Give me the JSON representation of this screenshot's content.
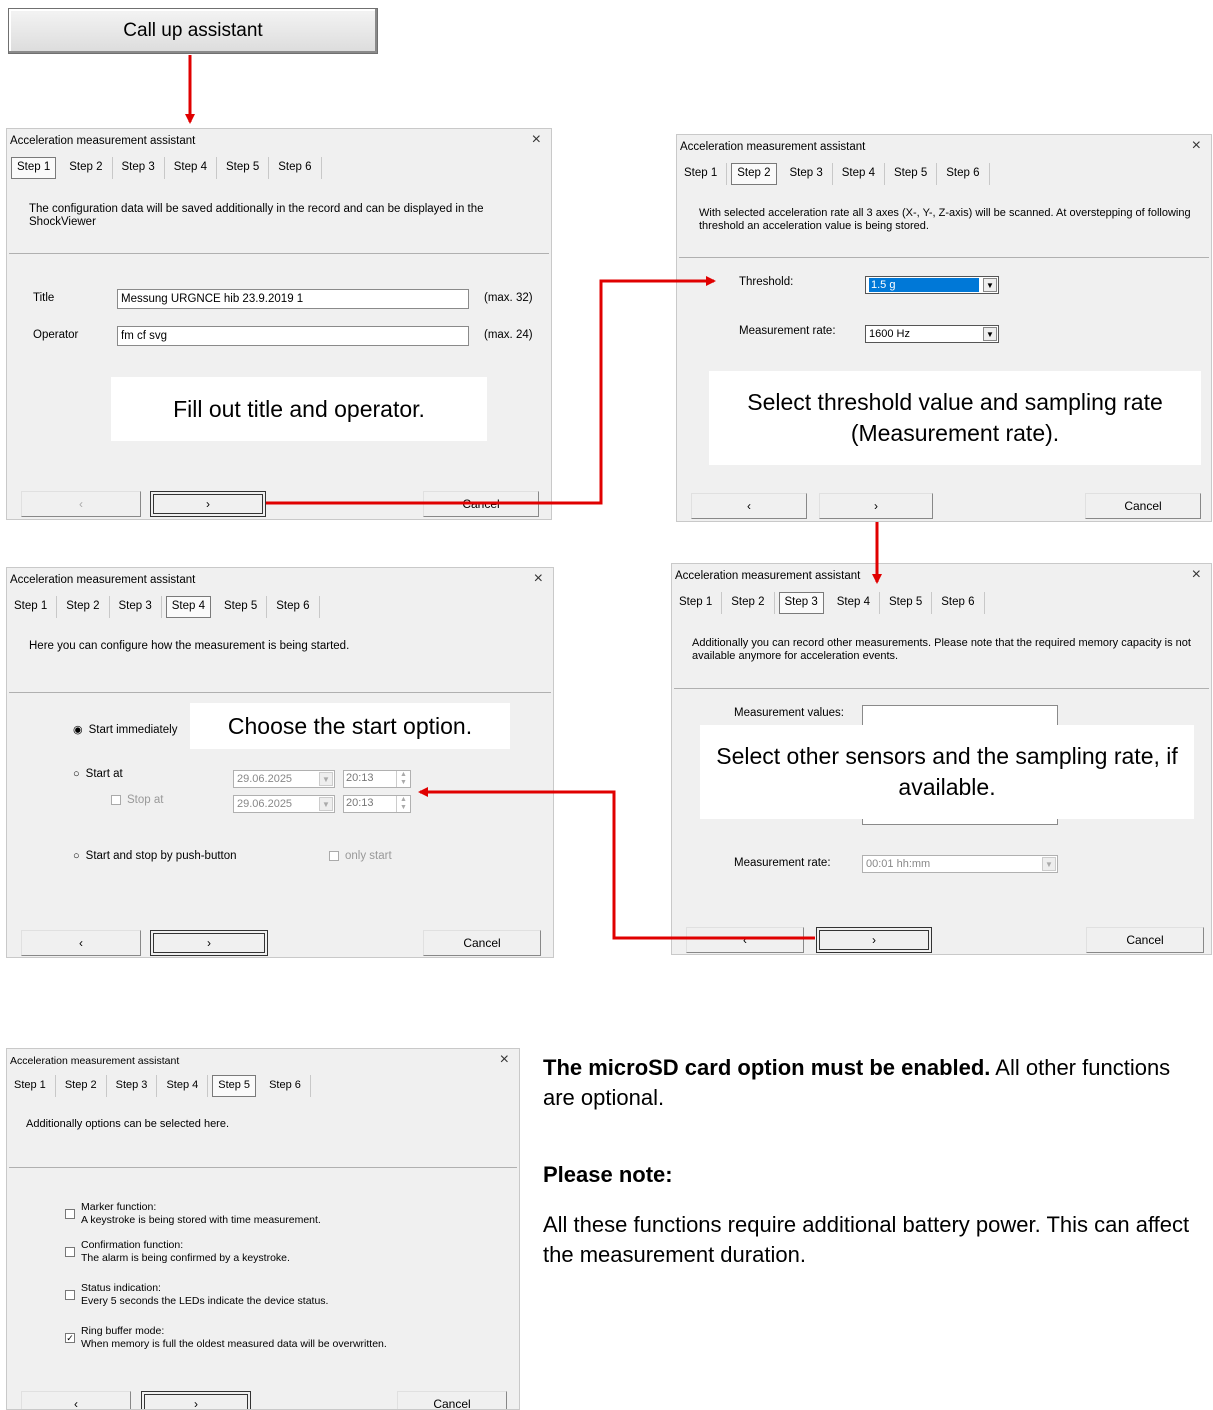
{
  "top_button": {
    "label": "Call up assistant"
  },
  "dialog_title": "Acceleration measurement assistant",
  "close_glyph": "×",
  "tabs": [
    "Step 1",
    "Step 2",
    "Step 3",
    "Step 4",
    "Step 5",
    "Step 6"
  ],
  "nav": {
    "back": "‹",
    "next": "›",
    "cancel": "Cancel"
  },
  "step1": {
    "description": "The configuration data will be saved additionally in the record and can be displayed in the ShockViewer",
    "title_label": "Title",
    "title_value": "Messung URGNCE hib 23.9.2019 1",
    "title_max": "(max. 32)",
    "operator_label": "Operator",
    "operator_value": "fm cf svg",
    "operator_max": "(max. 24)",
    "note": "Fill out title and operator."
  },
  "step2": {
    "description": "With selected acceleration rate all 3 axes (X-, Y-, Z-axis) will be scanned. At overstepping of following threshold an acceleration value is being stored.",
    "threshold_label": "Threshold:",
    "threshold_value": "1.5 g",
    "rate_label": "Measurement rate:",
    "rate_value": "1600 Hz",
    "note": "Select threshold value and sampling rate (Measurement rate)."
  },
  "step3": {
    "description": "Additionally you can record other measurements. Please note that the required memory capacity is not available anymore for acceleration events.",
    "values_label": "Measurement values:",
    "rate_label": "Measurement rate:",
    "rate_value": "00:01 hh:mm",
    "note": "Select other sensors and the sampling rate, if available."
  },
  "step4": {
    "description": "Here you can configure how the measurement is being started.",
    "opt_immediately": "Start immediately",
    "opt_start_at": "Start at",
    "stop_at": "Stop at",
    "date1": "29.06.2025",
    "time1": "20:13",
    "date2": "29.06.2025",
    "time2": "20:13",
    "opt_pushbutton": "Start and stop by push-button",
    "only_start": "only start",
    "note": "Choose the start option."
  },
  "step5": {
    "description": "Additionally options can be selected here.",
    "options": [
      {
        "title": "Marker function:",
        "text": "A keystroke is being stored with time measurement.",
        "checked": false
      },
      {
        "title": "Confirmation function:",
        "text": "The alarm is being confirmed by a keystroke.",
        "checked": false
      },
      {
        "title": "Status indication:",
        "text": "Every 5 seconds the LEDs indicate the device status.",
        "checked": false
      },
      {
        "title": "Ring buffer mode:",
        "text": "When memory is full the oldest measured data will be overwritten.",
        "checked": true
      }
    ]
  },
  "side_text": {
    "bold": "The microSD card option must be enabled.",
    "rest": " All other functions are optional.",
    "note_heading": "Please note:",
    "note_body": "All these functions require additional battery power. This can affect the measurement duration."
  },
  "colors": {
    "arrow": "#e00000",
    "dialog_bg": "#f0f0f0",
    "selection": "#0078d7"
  }
}
